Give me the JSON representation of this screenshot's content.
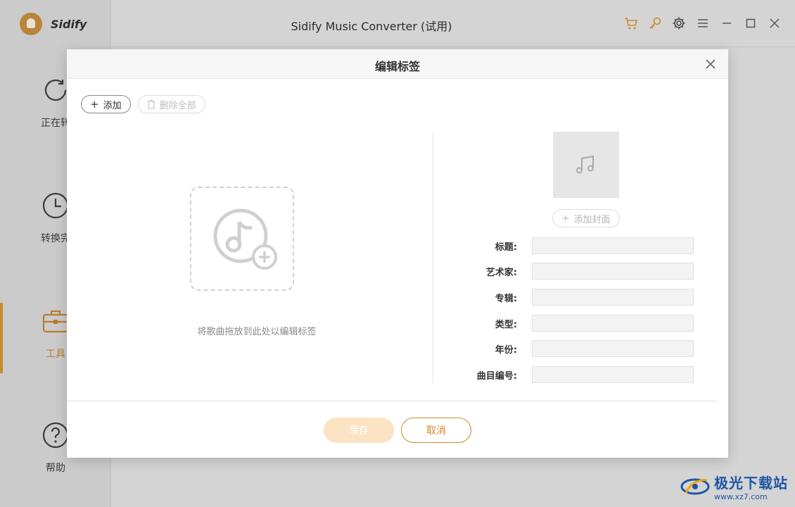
{
  "app": {
    "brand_name": "Sidify",
    "title": "Sidify Music Converter (试用)"
  },
  "sidebar": {
    "items": [
      {
        "label": "正在转",
        "icon": "converting-icon"
      },
      {
        "label": "转换完",
        "icon": "clock-icon"
      },
      {
        "label": "工具",
        "icon": "toolbox-icon",
        "active": true
      },
      {
        "label": "帮助",
        "icon": "help-icon"
      }
    ]
  },
  "titlebar_icons": [
    "cart-icon",
    "key-icon",
    "gear-icon",
    "menu-icon",
    "minimize-icon",
    "maximize-icon",
    "close-icon"
  ],
  "dialog": {
    "title": "编辑标签",
    "add_label": "添加",
    "delete_all_label": "删除全部",
    "drop_hint": "将歌曲拖放到此处以编辑标签",
    "add_cover_label": "添加封面",
    "fields": {
      "title": {
        "label": "标题:",
        "value": ""
      },
      "artist": {
        "label": "艺术家:",
        "value": ""
      },
      "album": {
        "label": "专辑:",
        "value": ""
      },
      "genre": {
        "label": "类型:",
        "value": ""
      },
      "year": {
        "label": "年份:",
        "value": ""
      },
      "track": {
        "label": "曲目编号:",
        "value": ""
      }
    },
    "save_label": "保存",
    "cancel_label": "取消"
  },
  "watermark": {
    "title": "极光下载站",
    "url": "www.xz7.com"
  },
  "colors": {
    "accent": "#d2872a",
    "save_disabled": "#fbe3c4"
  }
}
